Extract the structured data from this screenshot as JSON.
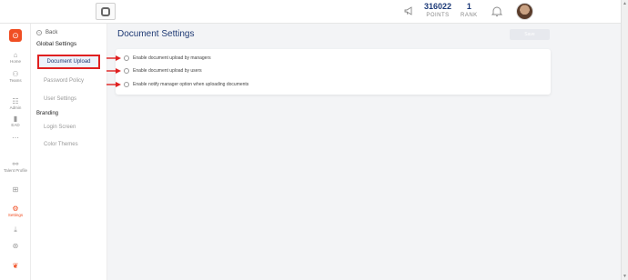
{
  "header": {
    "points_value": "316022",
    "points_label": "POINTS",
    "rank_value": "1",
    "rank_label": "RANK"
  },
  "rail": {
    "items": [
      {
        "label": "Home"
      },
      {
        "label": "Teams"
      },
      {
        "label": "Admin"
      },
      {
        "label": "EAD"
      },
      {
        "label": ""
      },
      {
        "label": "Talent Profile"
      },
      {
        "label": ""
      },
      {
        "label": "Settings"
      }
    ]
  },
  "subnav": {
    "back_label": "Back",
    "global_heading": "Global Settings",
    "document_upload": "Document Upload",
    "password_policy": "Password Policy",
    "user_settings": "User Settings",
    "branding_heading": "Branding",
    "login_screen": "Login Screen",
    "color_themes": "Color Themes"
  },
  "main": {
    "title": "Document Settings",
    "save_label": "Save",
    "options": [
      "Enable document upload by managers",
      "Enable document upload by users",
      "Enable notify manager option when uploading documents"
    ]
  },
  "colors": {
    "accent": "#f04e23",
    "navy": "#1f3a74",
    "highlight_red": "#e02020"
  }
}
